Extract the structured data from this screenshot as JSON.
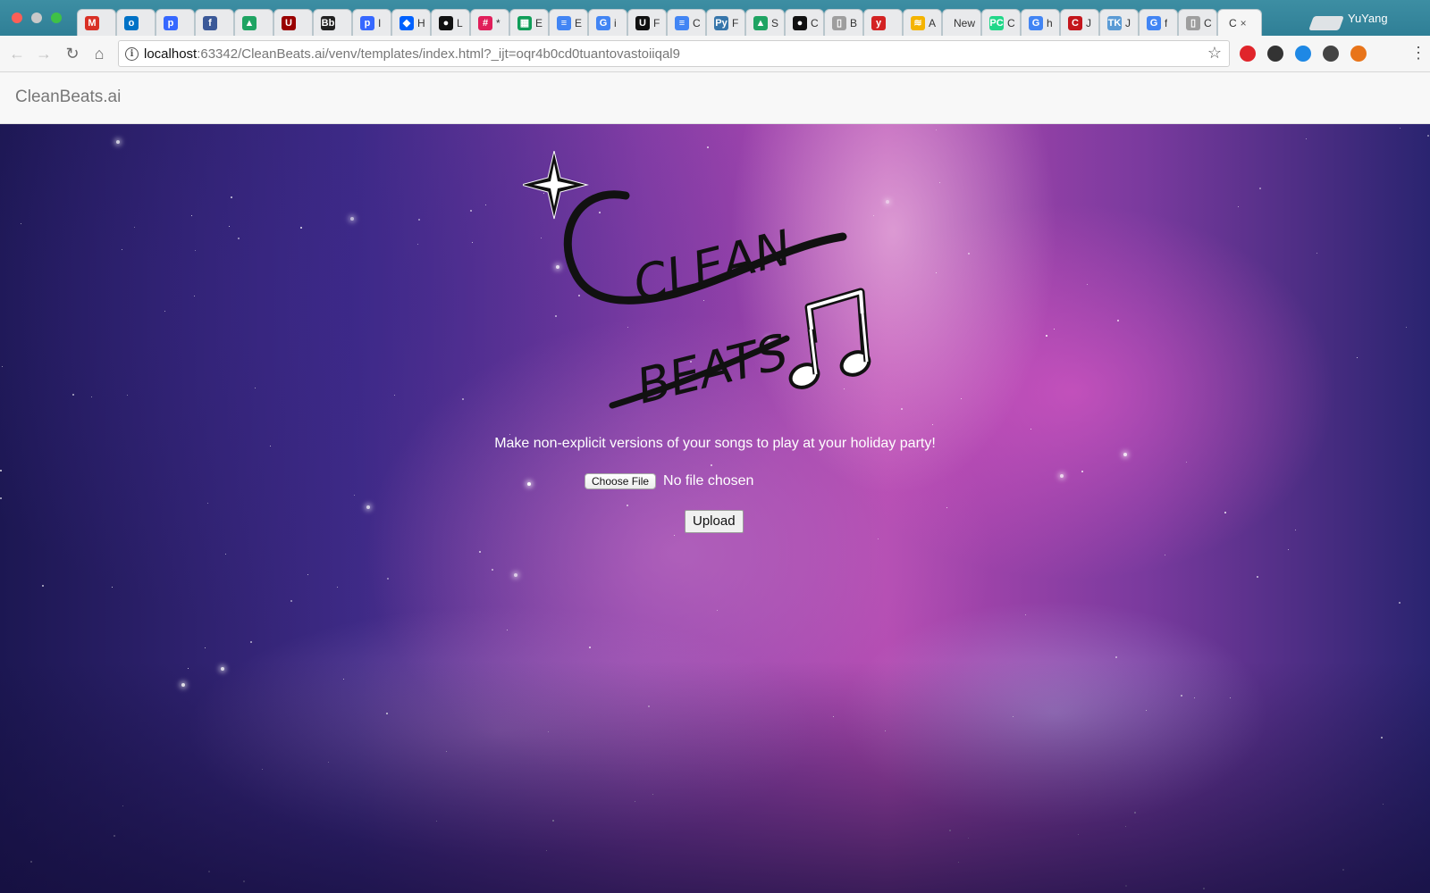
{
  "browser": {
    "tabs": [
      {
        "icon": "gmail-icon",
        "text": "",
        "color": "#d93025",
        "glyph": "M"
      },
      {
        "icon": "outlook-icon",
        "text": "",
        "color": "#0072c6",
        "glyph": "o"
      },
      {
        "icon": "pandora-icon",
        "text": "",
        "color": "#3668ff",
        "glyph": "p"
      },
      {
        "icon": "facebook-icon",
        "text": "",
        "color": "#3b5998",
        "glyph": "f"
      },
      {
        "icon": "google-drive-icon",
        "text": "",
        "color": "#1fa463",
        "glyph": "▲"
      },
      {
        "icon": "usc-icon",
        "text": "",
        "color": "#990000",
        "glyph": "U"
      },
      {
        "icon": "blackboard-icon",
        "text": "",
        "color": "#222222",
        "glyph": "Bb"
      },
      {
        "icon": "pandora-icon",
        "text": "I",
        "color": "#3668ff",
        "glyph": "p"
      },
      {
        "icon": "dropbox-icon",
        "text": "H",
        "color": "#0061fe",
        "glyph": "◆"
      },
      {
        "icon": "github-icon",
        "text": "L",
        "color": "#111111",
        "glyph": "●"
      },
      {
        "icon": "slack-icon",
        "text": "*",
        "color": "#e01e5a",
        "glyph": "#"
      },
      {
        "icon": "google-sheets-icon",
        "text": "E",
        "color": "#0f9d58",
        "glyph": "▦"
      },
      {
        "icon": "google-docs-icon",
        "text": "E",
        "color": "#4285f4",
        "glyph": "≡"
      },
      {
        "icon": "google-icon",
        "text": "i",
        "color": "#4285f4",
        "glyph": "G"
      },
      {
        "icon": "usc-icon",
        "text": "F",
        "color": "#111111",
        "glyph": "U"
      },
      {
        "icon": "google-docs-icon",
        "text": "C",
        "color": "#4285f4",
        "glyph": "≡"
      },
      {
        "icon": "python-icon",
        "text": "F",
        "color": "#3776ab",
        "glyph": "Py"
      },
      {
        "icon": "google-drive-icon",
        "text": "S",
        "color": "#1fa463",
        "glyph": "▲"
      },
      {
        "icon": "github-icon",
        "text": "C",
        "color": "#111111",
        "glyph": "●"
      },
      {
        "icon": "document-icon",
        "text": "B",
        "color": "#9e9e9e",
        "glyph": "▯"
      },
      {
        "icon": "yelp-icon",
        "text": "",
        "color": "#d32323",
        "glyph": "y"
      },
      {
        "icon": "page-icon",
        "text": "A",
        "color": "#f4b400",
        "glyph": "≋"
      },
      {
        "icon": "",
        "text": "New",
        "color": "",
        "glyph": ""
      },
      {
        "icon": "pycharm-icon",
        "text": "C",
        "color": "#21d789",
        "glyph": "PC"
      },
      {
        "icon": "google-icon",
        "text": "h",
        "color": "#4285f4",
        "glyph": "G"
      },
      {
        "icon": "c-icon",
        "text": "J",
        "color": "#c4161c",
        "glyph": "C"
      },
      {
        "icon": "tk-icon",
        "text": "J",
        "color": "#5b9bd5",
        "glyph": "TK"
      },
      {
        "icon": "google-icon",
        "text": "f",
        "color": "#4285f4",
        "glyph": "G"
      },
      {
        "icon": "document-icon",
        "text": "C",
        "color": "#9e9e9e",
        "glyph": "▯"
      },
      {
        "icon": "",
        "text": "C",
        "color": "",
        "glyph": "",
        "active": true
      }
    ],
    "close_glyph": "×",
    "profile_name": "YuYang",
    "url_host": "localhost",
    "url_rest": ":63342/CleanBeats.ai/venv/templates/index.html?_ijt=oqr4b0cd0tuantovastoiiqal9",
    "extensions": [
      {
        "name": "opera-icon",
        "color": "#e0252b"
      },
      {
        "name": "dark-mode-icon",
        "color": "#333333"
      },
      {
        "name": "lightbulb-icon",
        "color": "#1e88e5"
      },
      {
        "name": "wrench-icon",
        "color": "#444444"
      },
      {
        "name": "shield-icon",
        "color": "#e8741a"
      }
    ]
  },
  "page": {
    "brand": "CleanBeats.ai",
    "logo_text_line1": "CLEAN",
    "logo_text_line2": "BEATS",
    "tagline": "Make non-explicit versions of your songs to play at your holiday party!",
    "choose_file_label": "Choose File",
    "file_status": "No file chosen",
    "upload_label": "Upload"
  }
}
